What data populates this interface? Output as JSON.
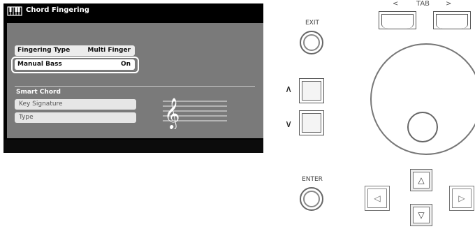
{
  "screen": {
    "title": "Chord Fingering",
    "title_icon": "keyboard-icon",
    "rows": [
      {
        "label": "Fingering Type",
        "value": "Multi Finger"
      },
      {
        "label": "Manual Bass",
        "value": "On"
      }
    ],
    "section_label": "Smart Chord",
    "items": [
      {
        "label": "Key Signature"
      },
      {
        "label": "Type"
      }
    ],
    "staff_icon": "treble-clef-staff-icon"
  },
  "panel": {
    "exit_label": "EXIT",
    "enter_label": "ENTER",
    "tab_label": "TAB",
    "tab_left_glyph": "<",
    "tab_right_glyph": ">",
    "up_glyph": "∧",
    "down_glyph": "∨",
    "cursor_up_glyph": "△",
    "cursor_down_glyph": "▽",
    "cursor_left_glyph": "◁",
    "cursor_right_glyph": "▷"
  },
  "colors": {
    "screen_bg": "#000000",
    "content_bg": "#7a7a7a",
    "highlight_border": "#ffffff"
  }
}
